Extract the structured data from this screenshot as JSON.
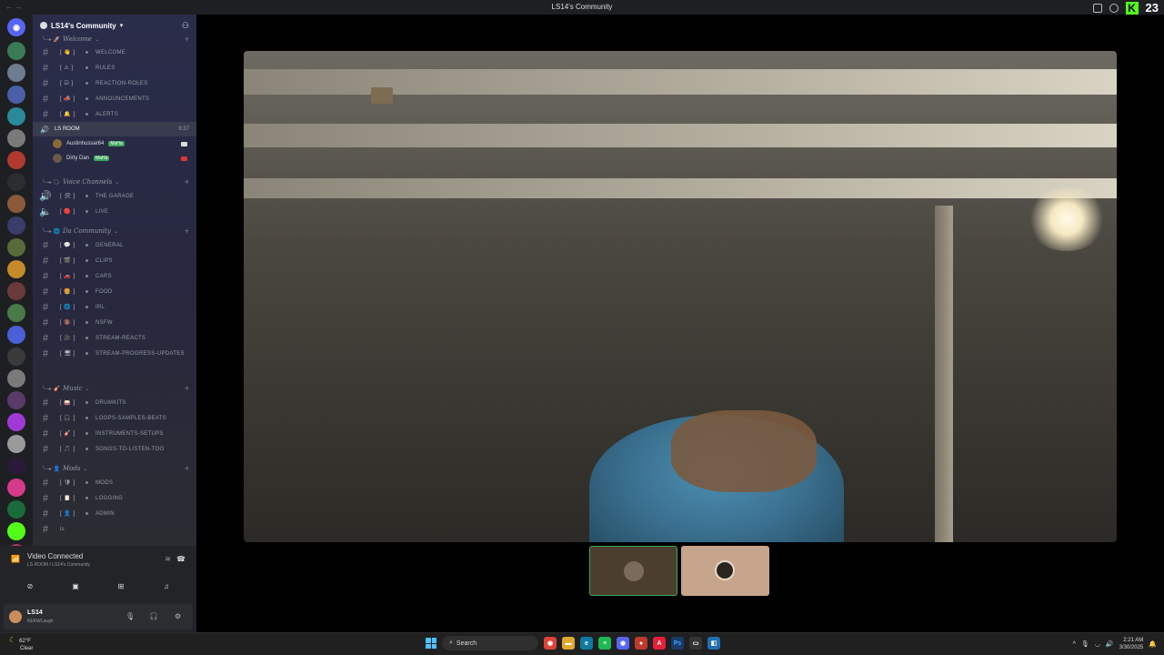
{
  "window": {
    "title": "LS14's Community",
    "nav": "← →",
    "kick_count": "23"
  },
  "server": {
    "name": "LS14's Community"
  },
  "categories": {
    "welcome": "Welcome",
    "voice": "Voice Channels",
    "community": "Da Community",
    "music": "Music",
    "mods": "Mods"
  },
  "channels": {
    "welcome": [
      {
        "emoji": "[ 👋 ]",
        "name": "welcome"
      },
      {
        "emoji": "[ ⚠ ]",
        "name": "rules"
      },
      {
        "emoji": "[ ☑ ]",
        "name": "reaction-roles"
      },
      {
        "emoji": "[ 📣 ]",
        "name": "announcements"
      },
      {
        "emoji": "[ 🔔 ]",
        "name": "alerts"
      }
    ],
    "voice_room": {
      "name": "LS ROOM",
      "time": "6:37"
    },
    "voice_users": [
      {
        "name": "Austinhussar64",
        "tag": "MaHa"
      },
      {
        "name": "Dirty Dan",
        "tag": "MaHa"
      }
    ],
    "voice": [
      {
        "emoji": "[ 🛠 ]",
        "name": "THE GARAGE"
      },
      {
        "emoji": "[ 🔴 ]",
        "name": "LIVE"
      }
    ],
    "community": [
      {
        "emoji": "[ 💬 ]",
        "name": "general"
      },
      {
        "emoji": "[ 🎬 ]",
        "name": "clips"
      },
      {
        "emoji": "[ 🚗 ]",
        "name": "cars"
      },
      {
        "emoji": "[ 🍔 ]",
        "name": "food"
      },
      {
        "emoji": "[ 🌐 ]",
        "name": "irl"
      },
      {
        "emoji": "[ 🔞 ]",
        "name": "nsfw"
      },
      {
        "emoji": "[ 🎥 ]",
        "name": "stream-reacts"
      },
      {
        "emoji": "[ 🖥 ]",
        "name": "stream-progress-updates"
      }
    ],
    "music": [
      {
        "emoji": "[ 🥁 ]",
        "name": "drumkits"
      },
      {
        "emoji": "[ 🎧 ]",
        "name": "loops-samples-beats"
      },
      {
        "emoji": "[ 🎸 ]",
        "name": "instruments-setups"
      },
      {
        "emoji": "[ 🎵 ]",
        "name": "songs-to-listen-too"
      }
    ],
    "mods": [
      {
        "emoji": "[ 🛡 ]",
        "name": "mods"
      },
      {
        "emoji": "[ 📋 ]",
        "name": "logging"
      },
      {
        "emoji": "[ 👤 ]",
        "name": "admin"
      }
    ],
    "extra": "ls"
  },
  "voice_panel": {
    "title": "Video Connected",
    "subtitle": "LS ROOM / LS14's Community"
  },
  "user_panel": {
    "name": "LS14",
    "status": "KEKWLaugh"
  },
  "taskbar": {
    "weather_temp": "62°F",
    "weather_desc": "Clear",
    "search": "Search",
    "time": "2:21 AM",
    "date": "3/30/2025"
  }
}
